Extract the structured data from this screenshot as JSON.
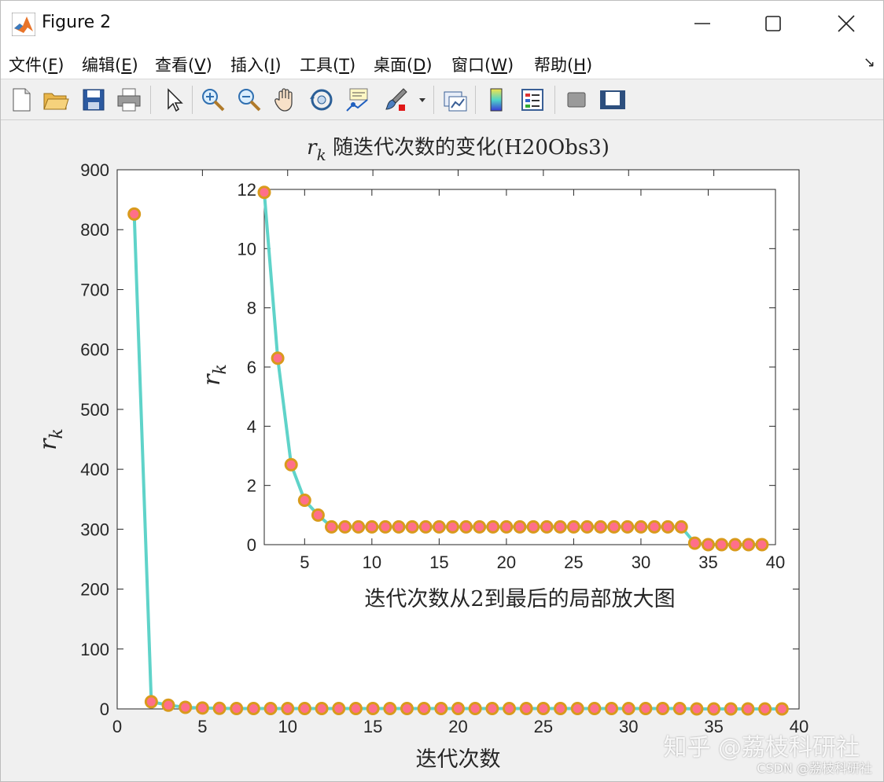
{
  "window": {
    "title": "Figure 2",
    "controls": {
      "minimize": "minimize",
      "maximize": "maximize",
      "close": "close"
    }
  },
  "menu": [
    {
      "label": "文件(",
      "key": "F",
      "tail": ")"
    },
    {
      "label": "编辑(",
      "key": "E",
      "tail": ")"
    },
    {
      "label": "查看(",
      "key": "V",
      "tail": ")"
    },
    {
      "label": "插入(",
      "key": "I",
      "tail": ")"
    },
    {
      "label": "工具(",
      "key": "T",
      "tail": ")"
    },
    {
      "label": "桌面(",
      "key": "D",
      "tail": ")"
    },
    {
      "label": "窗口(",
      "key": "W",
      "tail": ")"
    },
    {
      "label": "帮助(",
      "key": "H",
      "tail": ")"
    }
  ],
  "toolbar": [
    "new-file-icon",
    "open-folder-icon",
    "save-icon",
    "print-icon",
    "pointer-icon",
    "zoom-in-icon",
    "zoom-out-icon",
    "pan-hand-icon",
    "rotate-3d-icon",
    "data-cursor-icon",
    "brush-icon",
    "link-plot-icon",
    "colorbar-icon",
    "legend-icon",
    "hide-plot-tools-icon",
    "show-plot-tools-icon"
  ],
  "watermark": {
    "main": "知乎 @荔枝科研社",
    "sub": "CSDN @荔枝科研社"
  },
  "chart_data": [
    {
      "type": "line",
      "title_sym": "r",
      "title_sub": "k",
      "title_text": " 随迭代次数的变化(H20Obs3)",
      "xlabel": "迭代次数",
      "ylabel_sym": "r",
      "ylabel_sub": "k",
      "xlim": [
        0,
        40
      ],
      "ylim": [
        0,
        900
      ],
      "xticks": [
        0,
        5,
        10,
        15,
        20,
        25,
        30,
        35,
        40
      ],
      "yticks": [
        0,
        100,
        200,
        300,
        400,
        500,
        600,
        700,
        800,
        900
      ],
      "x": [
        1,
        2,
        3,
        4,
        5,
        6,
        7,
        8,
        9,
        10,
        11,
        12,
        13,
        14,
        15,
        16,
        17,
        18,
        19,
        20,
        21,
        22,
        23,
        24,
        25,
        26,
        27,
        28,
        29,
        30,
        31,
        32,
        33,
        34,
        35,
        36,
        37,
        38,
        39
      ],
      "values": [
        826,
        11.9,
        6.3,
        2.7,
        1.5,
        1.0,
        0.6,
        0.6,
        0.6,
        0.6,
        0.6,
        0.6,
        0.6,
        0.6,
        0.6,
        0.6,
        0.6,
        0.6,
        0.6,
        0.6,
        0.6,
        0.6,
        0.6,
        0.6,
        0.6,
        0.6,
        0.6,
        0.6,
        0.6,
        0.6,
        0.6,
        0.6,
        0.6,
        0.05,
        0.0,
        0.0,
        0.0,
        0.0,
        0.0
      ],
      "line_color": "#5fd3c9",
      "marker_face": "#ff6f8a",
      "marker_edge": "#d99a1c"
    },
    {
      "type": "line",
      "title": "",
      "xlabel": "迭代次数从2到最后的局部放大图",
      "ylabel_sym": "r",
      "ylabel_sub": "k",
      "xlim": [
        2,
        40
      ],
      "ylim": [
        0,
        12
      ],
      "xticks": [
        5,
        10,
        15,
        20,
        25,
        30,
        35,
        40
      ],
      "yticks": [
        0,
        2,
        4,
        6,
        8,
        10,
        12
      ],
      "x": [
        2,
        3,
        4,
        5,
        6,
        7,
        8,
        9,
        10,
        11,
        12,
        13,
        14,
        15,
        16,
        17,
        18,
        19,
        20,
        21,
        22,
        23,
        24,
        25,
        26,
        27,
        28,
        29,
        30,
        31,
        32,
        33,
        34,
        35,
        36,
        37,
        38,
        39
      ],
      "values": [
        11.9,
        6.3,
        2.7,
        1.5,
        1.0,
        0.6,
        0.6,
        0.6,
        0.6,
        0.6,
        0.6,
        0.6,
        0.6,
        0.6,
        0.6,
        0.6,
        0.6,
        0.6,
        0.6,
        0.6,
        0.6,
        0.6,
        0.6,
        0.6,
        0.6,
        0.6,
        0.6,
        0.6,
        0.6,
        0.6,
        0.6,
        0.6,
        0.05,
        0.0,
        0.0,
        0.0,
        0.0,
        0.0
      ],
      "line_color": "#5fd3c9",
      "marker_face": "#ff6f8a",
      "marker_edge": "#d99a1c"
    }
  ]
}
